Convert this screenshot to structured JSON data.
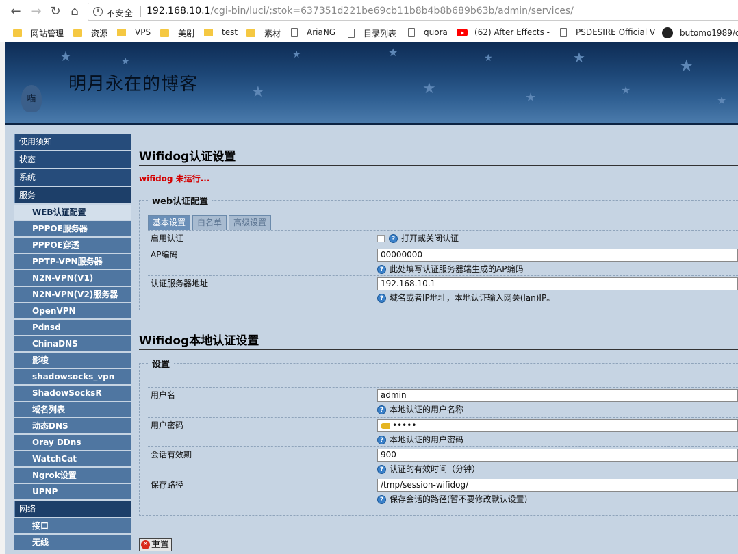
{
  "browser": {
    "insecure_label": "不安全",
    "url_host": "192.168.10.1",
    "url_path": "/cgi-bin/luci/;stok=637351d221be69cb11b8b4b8b689b63b/admin/services/",
    "bookmarks": [
      {
        "label": "网站管理",
        "icon": "folder-icon"
      },
      {
        "label": "资源",
        "icon": "folder-icon"
      },
      {
        "label": "VPS",
        "icon": "folder-icon"
      },
      {
        "label": "美剧",
        "icon": "folder-icon"
      },
      {
        "label": "test",
        "icon": "folder-icon"
      },
      {
        "label": "素材",
        "icon": "folder-icon"
      },
      {
        "label": "AriaNG",
        "icon": "page-icon"
      },
      {
        "label": "目录列表",
        "icon": "page-icon"
      },
      {
        "label": "quora",
        "icon": "page-icon"
      },
      {
        "label": "(62) After Effects -",
        "icon": "youtube-icon"
      },
      {
        "label": "PSDESIRE Official V",
        "icon": "page-icon"
      },
      {
        "label": "butomo1989/c",
        "icon": "github-icon"
      }
    ]
  },
  "banner": {
    "title": "明月永在的博客",
    "mascot": "喵"
  },
  "sidebar": {
    "cat_notice": "使用须知",
    "cat_status": "状态",
    "cat_system": "系统",
    "cat_services": "服务",
    "services_items": [
      "WEB认证配置",
      "PPPOE服务器",
      "PPPOE穿透",
      "PPTP-VPN服务器",
      "N2N-VPN(V1)",
      "N2N-VPN(V2)服务器",
      "OpenVPN",
      "Pdnsd",
      "ChinaDNS",
      "影梭",
      "shadowsocks_vpn",
      "ShadowSocksR",
      "域名列表",
      "动态DNS",
      "Oray DDns",
      "WatchCat",
      "Ngrok设置",
      "UPNP"
    ],
    "cat_network": "网络",
    "network_items": [
      "接口",
      "无线"
    ]
  },
  "section1": {
    "title": "Wifidog认证设置",
    "status": "wifidog 未运行...",
    "fieldset_legend": "web认证配置",
    "tabs": [
      "基本设置",
      "白名单",
      "高级设置"
    ],
    "enable_label": "启用认证",
    "enable_hint": "打开或关闭认证",
    "ap_label": "AP编码",
    "ap_value": "00000000",
    "ap_hint": "此处填写认证服务器端生成的AP编码",
    "server_label": "认证服务器地址",
    "server_value": "192.168.10.1",
    "server_hint": "域名或者IP地址，本地认证输入网关(lan)IP。"
  },
  "section2": {
    "title": "Wifidog本地认证设置",
    "fieldset_legend": "设置",
    "user_label": "用户名",
    "user_value": "admin",
    "user_hint": "本地认证的用户名称",
    "pass_label": "用户密码",
    "pass_value": "•••••",
    "pass_hint": "本地认证的用户密码",
    "timeout_label": "会话有效期",
    "timeout_value": "900",
    "timeout_hint": "认证的有效时间（分钟）",
    "path_label": "保存路径",
    "path_value": "/tmp/session-wifidog/",
    "path_hint": "保存会话的路径(暂不要修改默认设置)"
  },
  "reset_button": "重置",
  "colors": {
    "sidebar_category": "#264c7b",
    "sidebar_item": "#4f76a1",
    "page_background": "#c6d4e3",
    "status_red": "#d40000"
  }
}
